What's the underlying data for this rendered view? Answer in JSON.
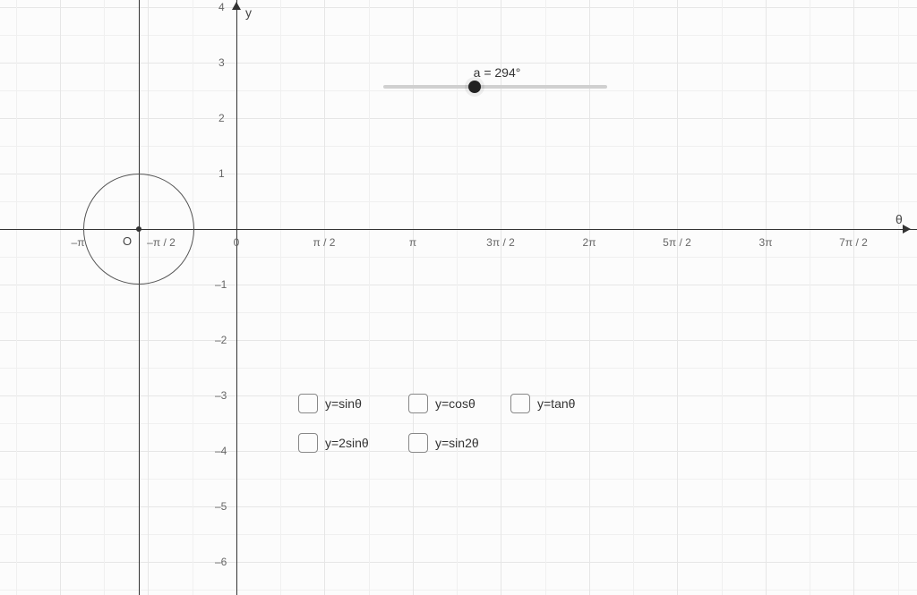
{
  "chart_data": {
    "type": "line",
    "title": "",
    "xlabel": "θ",
    "ylabel": "y",
    "xlim": [
      "-π",
      "7π/2"
    ],
    "ylim": [
      -6,
      4
    ],
    "x_ticks": [
      "–π",
      "–π / 2",
      "0",
      "π / 2",
      "π",
      "3π / 2",
      "2π",
      "5π / 2",
      "3π",
      "7π / 2"
    ],
    "y_ticks": [
      -6,
      -5,
      -4,
      -3,
      -2,
      -1,
      1,
      2,
      3,
      4
    ],
    "origin_label": "O",
    "unit_circle": {
      "center": [
        "-π/2",
        0
      ],
      "radius": 1
    },
    "unit_circle_point": [
      "-π/2",
      0
    ],
    "inner_vertical_line_x": "-π/2",
    "slider": {
      "label_prefix": "a = ",
      "value": 294,
      "unit": "°",
      "min": 0,
      "max": 720,
      "position": {
        "track_x_start": "≈1.29π",
        "track_x_end": "≈2.09π",
        "y": 2.6
      }
    },
    "checkboxes": [
      {
        "label": "y=sinθ",
        "checked": false
      },
      {
        "label": "y=cosθ",
        "checked": false
      },
      {
        "label": "y=tanθ",
        "checked": false
      },
      {
        "label": "y=2sinθ",
        "checked": false
      },
      {
        "label": "y=sin2θ",
        "checked": false
      }
    ],
    "series": []
  },
  "axis": {
    "x_label": "θ",
    "y_label": "y",
    "origin": "O"
  },
  "slider_text": "a = 294°",
  "cb": {
    "sin": "y=sinθ",
    "cos": "y=cosθ",
    "tan": "y=tanθ",
    "twosin": "y=2sinθ",
    "sin2": "y=sin2θ"
  },
  "xticks": {
    "mpi": "–π",
    "mpi2": "–π / 2",
    "zero": "0",
    "pi2": "π / 2",
    "pi": "π",
    "threepi2": "3π / 2",
    "twopi": "2π",
    "fivepi2": "5π / 2",
    "threepi": "3π",
    "sevenpi2": "7π / 2"
  },
  "yticks": {
    "m6": "–6",
    "m5": "–5",
    "m4": "–4",
    "m3": "–3",
    "m2": "–2",
    "m1": "–1",
    "p1": "1",
    "p2": "2",
    "p3": "3",
    "p4": "4"
  }
}
